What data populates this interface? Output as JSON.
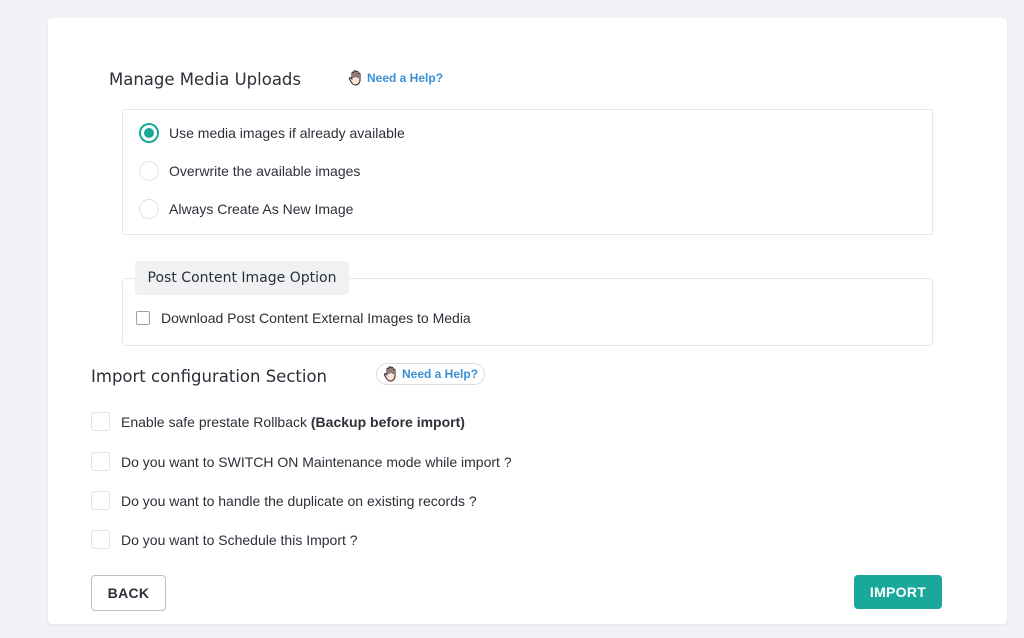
{
  "manage_media": {
    "title": "Manage Media Uploads",
    "help_label": "Need a Help?",
    "options": [
      {
        "label": "Use media images if already available",
        "checked": true
      },
      {
        "label": "Overwrite the available images",
        "checked": false
      },
      {
        "label": "Always Create As New Image",
        "checked": false
      }
    ]
  },
  "post_content": {
    "legend": "Post Content Image Option",
    "checkbox_label": "Download Post Content External Images to Media"
  },
  "import_config": {
    "title": "Import configuration Section",
    "help_label": "Need a Help?",
    "options": [
      {
        "label": "Enable safe prestate Rollback ",
        "bold_suffix": "(Backup before import)"
      },
      {
        "label": "Do you want to SWITCH ON Maintenance mode while import ?"
      },
      {
        "label": "Do you want to handle the duplicate on existing records ?"
      },
      {
        "label": "Do you want to Schedule this Import ?"
      }
    ]
  },
  "footer": {
    "back_label": "BACK",
    "import_label": "IMPORT"
  },
  "colors": {
    "accent": "#1aa89b",
    "link": "#3a8fd6",
    "background": "#f1f2f6"
  }
}
